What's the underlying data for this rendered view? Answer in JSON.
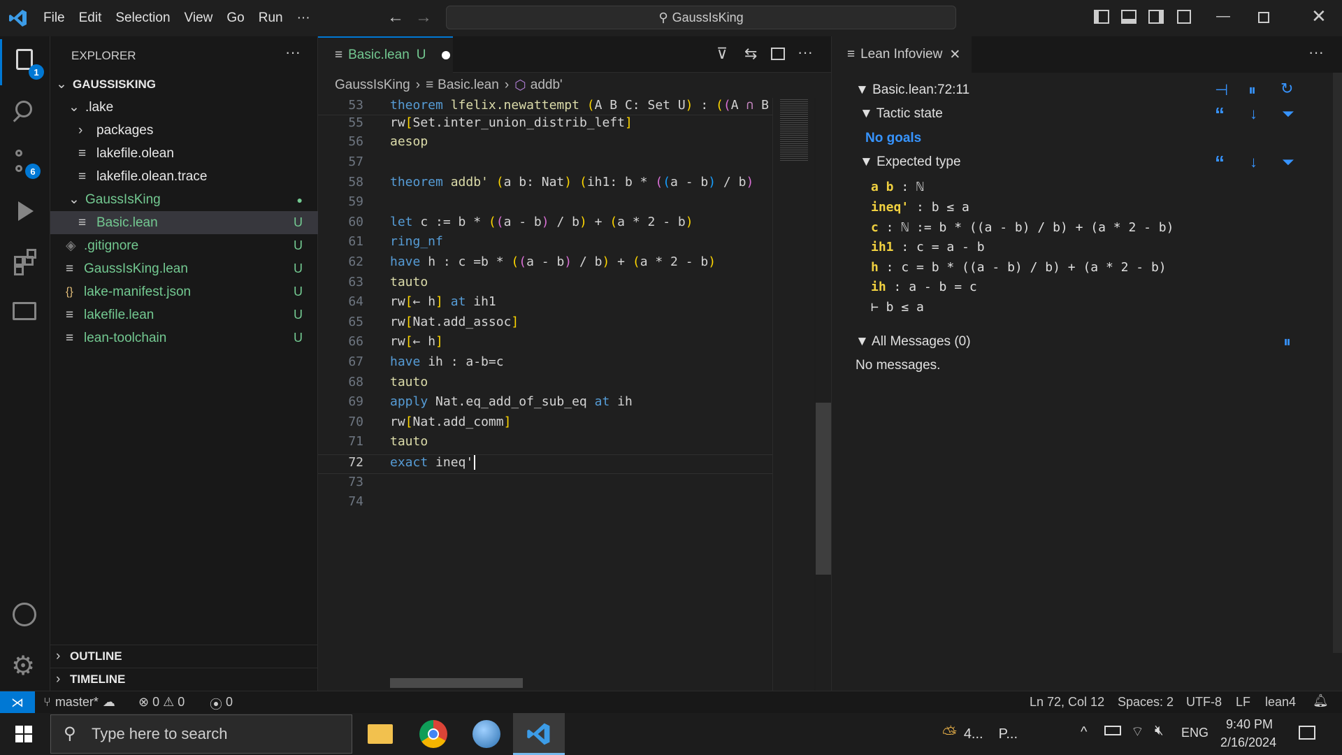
{
  "titlebar": {
    "menu": [
      "File",
      "Edit",
      "Selection",
      "View",
      "Go",
      "Run",
      "···"
    ],
    "search_text": "GaussIsKing"
  },
  "activity": {
    "explorer_badge": "1",
    "scm_badge": "6"
  },
  "sidebar": {
    "title": "EXPLORER",
    "root": "GAUSSISKING",
    "rows": [
      {
        "label": ".lake",
        "git": ""
      },
      {
        "label": "packages",
        "git": ""
      },
      {
        "label": "lakefile.olean",
        "git": ""
      },
      {
        "label": "lakefile.olean.trace",
        "git": ""
      },
      {
        "label": "GaussIsKing",
        "git": "●"
      },
      {
        "label": "Basic.lean",
        "git": "U"
      },
      {
        "label": ".gitignore",
        "git": "U"
      },
      {
        "label": "GaussIsKing.lean",
        "git": "U"
      },
      {
        "label": "lake-manifest.json",
        "git": "U"
      },
      {
        "label": "lakefile.lean",
        "git": "U"
      },
      {
        "label": "lean-toolchain",
        "git": "U"
      }
    ],
    "outline": "OUTLINE",
    "timeline": "TIMELINE"
  },
  "editor": {
    "tab_label": "Basic.lean",
    "tab_status": "U",
    "breadcrumb": [
      "GaussIsKing",
      "Basic.lean",
      "addb'"
    ],
    "line_numbers": [
      "53",
      "55",
      "56",
      "57",
      "58",
      "59",
      "60",
      "61",
      "62",
      "63",
      "64",
      "65",
      "66",
      "67",
      "68",
      "69",
      "70",
      "71",
      "72",
      "73",
      "74"
    ]
  },
  "infoview": {
    "tab_label": "Lean Infoview",
    "position": "Basic.lean:72:11",
    "tactic_state": "Tactic state",
    "no_goals": "No goals",
    "expected_type": "Expected type",
    "hyps": [
      {
        "name": "a b",
        "type": " : ℕ"
      },
      {
        "name": "ineq'",
        "type": " : b ≤ a"
      },
      {
        "name": "c",
        "type": " : ℕ := b * ((a - b) / b) + (a * 2 - b)"
      },
      {
        "name": "ih1",
        "type": " : c = a - b"
      },
      {
        "name": "h",
        "type": " : c = b * ((a - b) / b) + (a * 2 - b)"
      },
      {
        "name": "ih",
        "type": " : a - b = c"
      }
    ],
    "goal": "⊢ b ≤ a",
    "all_messages": "All Messages (0)",
    "no_messages": "No messages."
  },
  "statusbar": {
    "branch": "master*",
    "errors": "0",
    "warnings": "0",
    "ports": "0",
    "position": "Ln 72, Col 12",
    "spaces": "Spaces: 2",
    "encoding": "UTF-8",
    "eol": "LF",
    "language": "lean4"
  },
  "taskbar": {
    "search_placeholder": "Type here to search",
    "weather": "4...",
    "weather2": "P...",
    "lang": "ENG",
    "time": "9:40 PM",
    "date": "2/16/2024"
  },
  "colors": {
    "accent": "#0078d4",
    "git_untracked": "#73c991"
  }
}
